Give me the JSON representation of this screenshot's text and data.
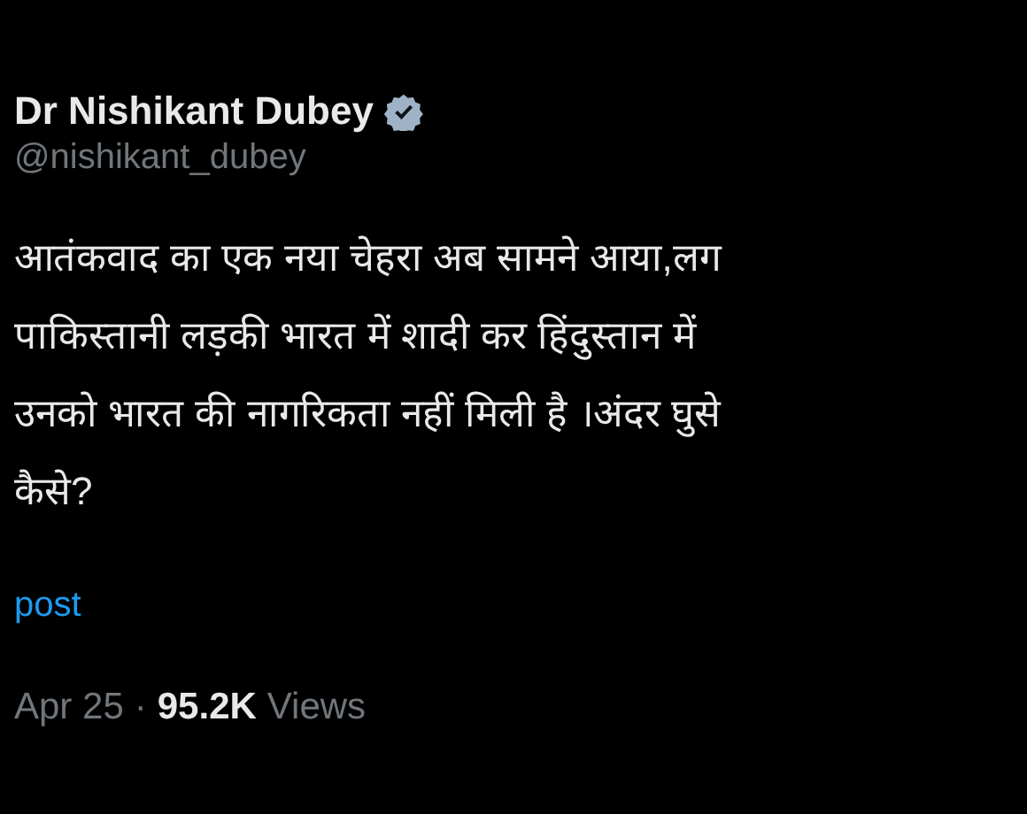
{
  "author": {
    "name": "Dr Nishikant Dubey",
    "verified": true,
    "handle": "@nishikant_dubey"
  },
  "post_lines": [
    "आतंकवाद का एक नया चेहरा अब सामने आया,लग",
    "पाकिस्तानी लड़की भारत में शादी कर हिंदुस्तान में",
    "उनको भारत की नागरिकता नहीं मिली है ।अंदर घुसे",
    "कैसे?"
  ],
  "translate_link": "post",
  "meta": {
    "date": "Apr 25",
    "separator": "·",
    "views_count": "95.2K",
    "views_label": "Views"
  }
}
